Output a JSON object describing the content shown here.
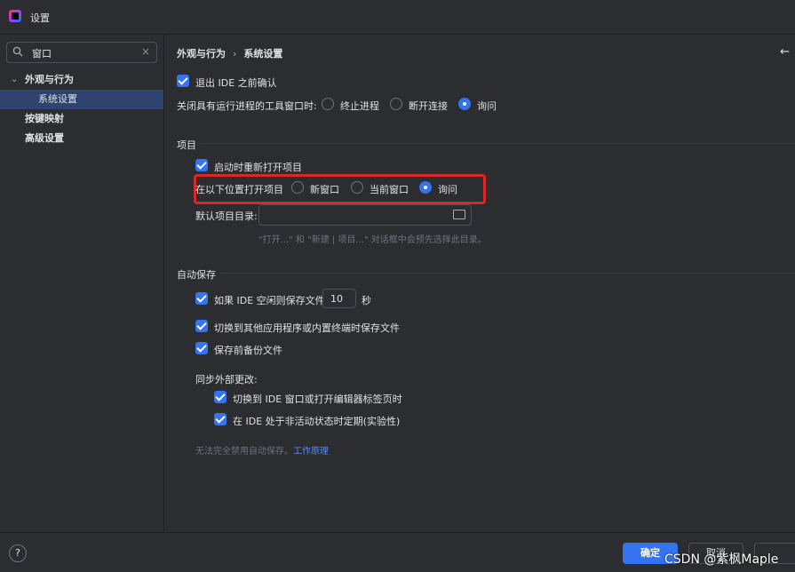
{
  "window": {
    "title": "设置"
  },
  "sidebar": {
    "search_value": "窗口",
    "items": [
      {
        "label": "外观与行为"
      },
      {
        "label": "系统设置"
      },
      {
        "label": "按键映射"
      },
      {
        "label": "高级设置"
      }
    ]
  },
  "breadcrumb": {
    "parent": "外观与行为",
    "separator": "›",
    "current": "系统设置"
  },
  "general": {
    "confirm_exit_label": "退出 IDE 之前确认",
    "close_tool_label": "关闭具有运行进程的工具窗口时:",
    "options": [
      "终止进程",
      "断开连接",
      "询问"
    ]
  },
  "project": {
    "section_title": "项目",
    "reopen_label": "启动时重新打开项目",
    "open_location_label": "在以下位置打开项目",
    "open_options": [
      "新窗口",
      "当前窗口",
      "询问"
    ],
    "default_dir_label": "默认项目目录:",
    "default_dir_value": "",
    "hint": "\"打开...\" 和 \"新建 | 项目...\" 对话框中会预先选择此目录。"
  },
  "autosave": {
    "section_title": "自动保存",
    "idle_label": "如果 IDE 空闲则保存文件",
    "idle_seconds": "10",
    "seconds_unit": "秒",
    "switch_label": "切换到其他应用程序或内置终端时保存文件",
    "backup_label": "保存前备份文件",
    "sync_title": "同步外部更改:",
    "sync_switch_label": "切换到 IDE 窗口或打开编辑器标签页时",
    "sync_periodic_label": "在 IDE 处于非活动状态时定期(实验性)",
    "note": "无法完全禁用自动保存。",
    "note_link": "工作原理"
  },
  "footer": {
    "help_label": "?",
    "ok_label": "确定",
    "cancel_label": "取消",
    "watermark": "CSDN @紫枫Maple"
  }
}
